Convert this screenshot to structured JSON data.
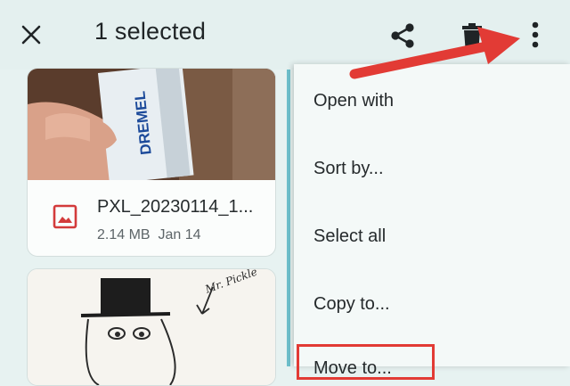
{
  "app_bar": {
    "close_icon": "close-icon",
    "title": "1 selected",
    "share_icon": "share-icon",
    "delete_icon": "trash-icon",
    "more_icon": "more-vert-icon"
  },
  "files": [
    {
      "thumbnail": "photo of a hand holding a Dremel tool box",
      "thumbnail_text": "DREMEL",
      "name": "PXL_20230114_1...",
      "meta": "2.14 MB  Jan 14",
      "type_icon": "image-icon",
      "selected": true
    },
    {
      "thumbnail": "drawing of a character in a top hat",
      "thumbnail_text": "Mr. Pickle"
    }
  ],
  "overflow_menu": {
    "items": [
      "Open with",
      "Sort by...",
      "Select all",
      "Copy to...",
      "Move to..."
    ]
  },
  "annotation": {
    "arrow_color": "#e23b35",
    "highlight_color": "#e23b35"
  },
  "colors": {
    "accent": "#6ec0cc",
    "file_icon": "#d33b3b",
    "background": "#e7f2f1"
  }
}
